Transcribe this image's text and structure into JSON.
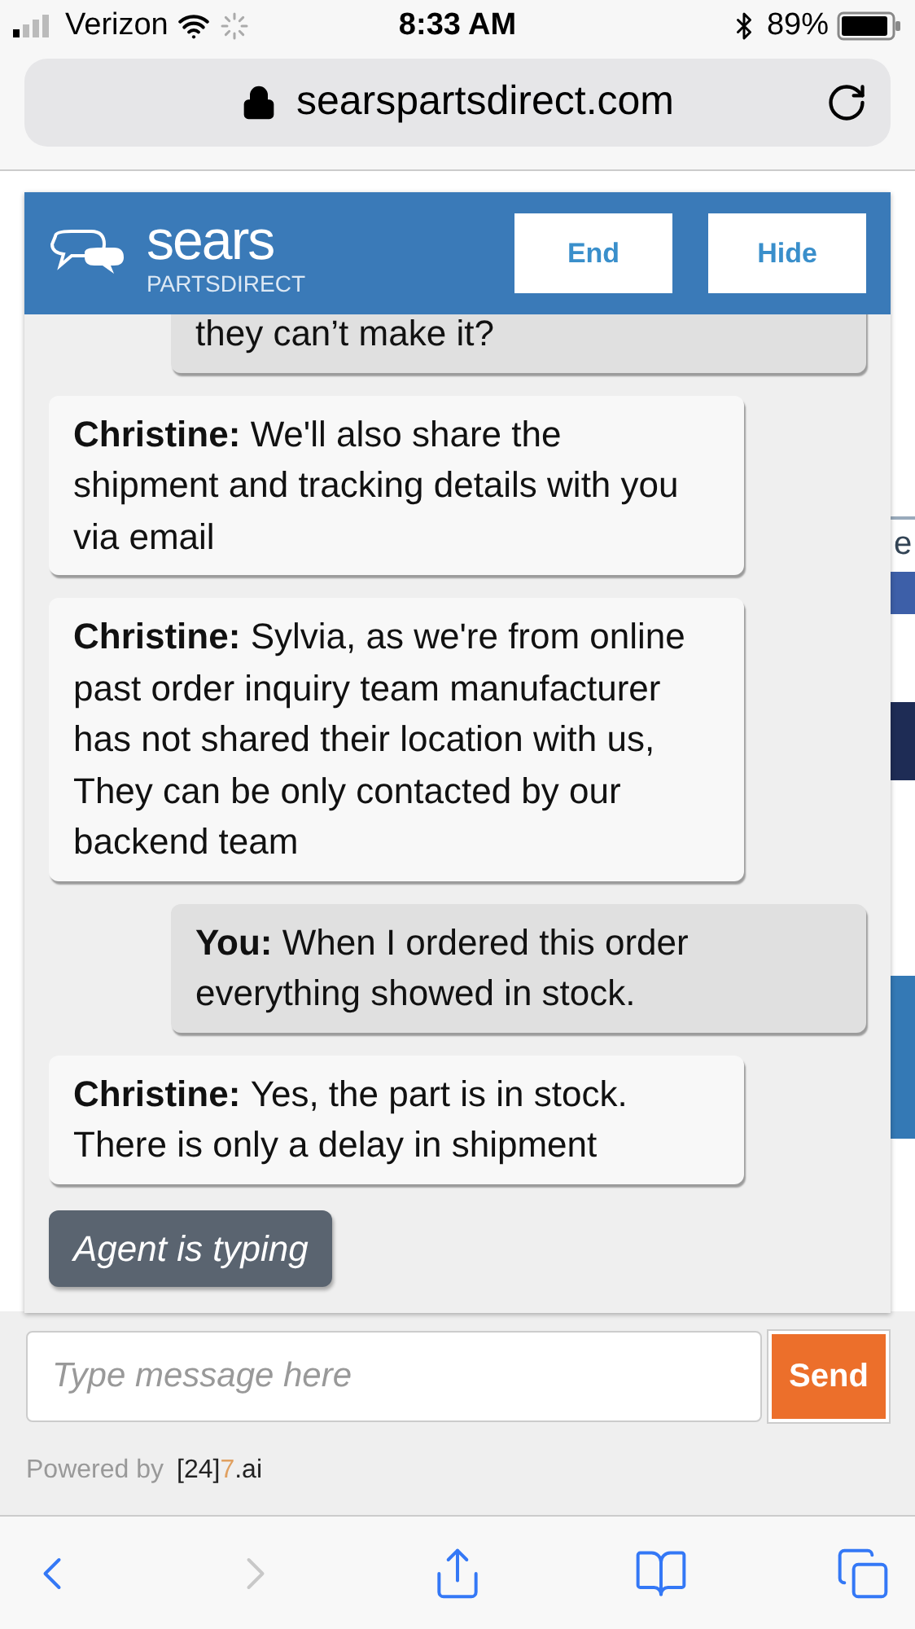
{
  "status_bar": {
    "carrier": "Verizon",
    "time": "8:33 AM",
    "battery": "89%"
  },
  "address_bar": {
    "url": "searspartsdirect.com"
  },
  "page_behind": {
    "edge_fragments": [
      "e"
    ]
  },
  "chat": {
    "brand": {
      "name": "sears",
      "sub": "PARTSDIRECT"
    },
    "buttons": [
      "End",
      "Hide"
    ],
    "messages": [
      {
        "kind": "user",
        "text": "they can’t make it?"
      },
      {
        "kind": "agent",
        "sender": "Christine:",
        "text": "We'll also share the shipment and tracking details with you via email"
      },
      {
        "kind": "agent",
        "sender": "Christine:",
        "text": "Sylvia, as we're from online past order inquiry team manufacturer has not shared their location with us, They can be only contacted by our backend team"
      },
      {
        "kind": "user",
        "sender": "You:",
        "text": "When I ordered this order everything showed in stock."
      },
      {
        "kind": "agent",
        "sender": "Christine:",
        "text": "Yes, the part is in stock. There is only a delay in shipment"
      }
    ],
    "typing_indicator": "Agent is typing",
    "input": {
      "placeholder": "Type message here"
    },
    "send_button": "Send",
    "powered_by": {
      "label": "Powered by",
      "logo": [
        "[24]",
        "7",
        ".ai"
      ]
    }
  },
  "browser_toolbar": [
    {
      "kind": "back",
      "disabled": false
    },
    {
      "kind": "forward",
      "disabled": true
    },
    {
      "kind": "share",
      "disabled": false
    },
    {
      "kind": "bookmarks",
      "disabled": false
    },
    {
      "kind": "tabs",
      "disabled": false
    }
  ]
}
